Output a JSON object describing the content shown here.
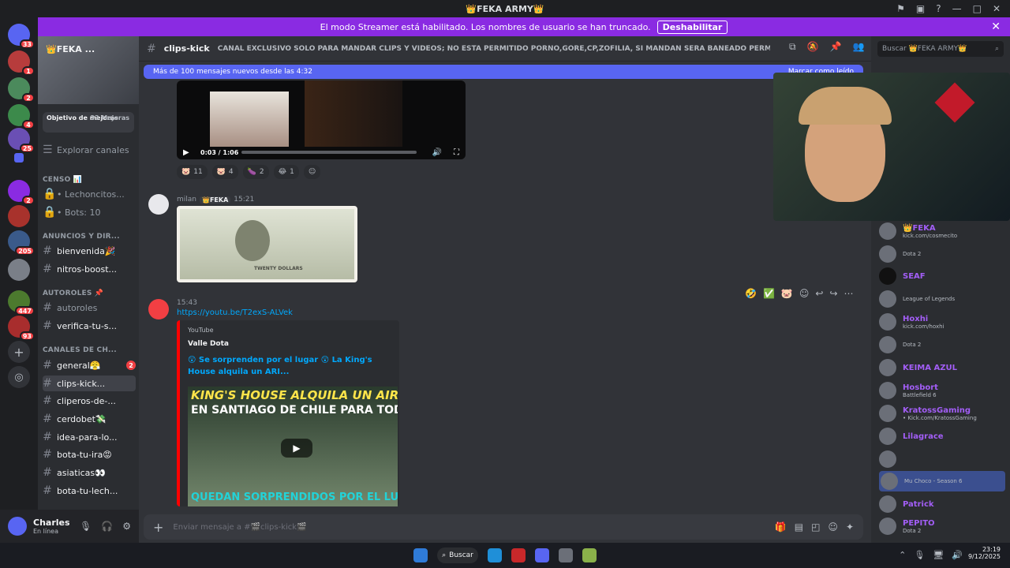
{
  "window": {
    "title": "👑FEKA ARMY👑",
    "controls": [
      "⚑",
      "▣",
      "?",
      "—",
      "□",
      "✕"
    ]
  },
  "banner": {
    "text": "El modo Streamer está habilitado. Los nombres de usuario se han truncado.",
    "button": "Deshabilitar",
    "close": "✕"
  },
  "guild_badges": [
    "33",
    "1",
    "2",
    "4",
    "25",
    "2",
    "205",
    "447",
    "93"
  ],
  "sidebar": {
    "server_name": "👑FEKA ...",
    "boost": {
      "label": "Objetivo de mejoras",
      "count": "33 Mejoras"
    },
    "explore": "Explorar canales",
    "categories": {
      "censo": "CENSO 📊",
      "anuncios": "ANUNCIOS Y DIR...",
      "autoroles": "AUTOROLES 📌",
      "canales": "CANALES DE CH..."
    },
    "items": [
      {
        "label": "• Lechoncitos..."
      },
      {
        "label": "• Bots: 10"
      },
      {
        "label": "bienvenida🎉"
      },
      {
        "label": "nitros-boost..."
      },
      {
        "label": "autoroles"
      },
      {
        "label": "verifica-tu-s..."
      },
      {
        "label": "general😤",
        "badge": "2"
      },
      {
        "label": "clips-kick..."
      },
      {
        "label": "cliperos-de-..."
      },
      {
        "label": "cerdobet💸"
      },
      {
        "label": "idea-para-lo..."
      },
      {
        "label": "bota-tu-ira😡"
      },
      {
        "label": "asiaticas👀"
      },
      {
        "label": "bota-tu-lech..."
      }
    ]
  },
  "user": {
    "name": "Charles",
    "status": "En línea"
  },
  "channel": {
    "name": "clips-kick",
    "topic": "CANAL EXCLUSIVO SOLO PARA MANDAR CLIPS Y VIDEOS; NO ESTA PERMITIDO PORNO,GORE,CP,ZOFILIA, SI MANDAN SERA BANEADO PERMANENTEMENTE",
    "new_messages": "Más de 100 mensajes nuevos desde las 4:32",
    "mark_read": "Marcar como leído"
  },
  "video": {
    "time": "0:03 / 1:06"
  },
  "reactions": [
    {
      "emoji": "🐷",
      "count": "11"
    },
    {
      "emoji": "🐷",
      "count": "4"
    },
    {
      "emoji": "🍆",
      "count": "2"
    },
    {
      "emoji": "😂",
      "count": "1"
    }
  ],
  "messages": [
    {
      "author": "milan",
      "tag": "👑FEKA",
      "time": "15:21"
    },
    {
      "author": "",
      "tag": "",
      "time": "15:43"
    }
  ],
  "bill": {
    "caption": "TWENTY DOLLARS"
  },
  "embed": {
    "link": "https://youtu.be/T2exS-ALVek",
    "provider": "YouTube",
    "author": "Valle Dota",
    "title": "😲 Se sorprenden por el lugar 😲 La King's House alquila un ARI...",
    "thumb_line1": "KING'S HOUSE ALQUILA UN AIRBNB",
    "thumb_line2": "EN SANTIAGO DE CHILE PARA TODOS",
    "thumb_line3": "QUEDAN SORPRENDIDOS POR EL LUGAR"
  },
  "composer": {
    "placeholder": "Enviar mensaje a #🎬clips-kick🎬"
  },
  "search": {
    "placeholder": "Buscar 👑FEKA ARMY👑"
  },
  "members": [
    {
      "name": "",
      "tag": "👑FEKA",
      "activity": "kick.com/cosmecito"
    },
    {
      "name": "",
      "activity": "Dota 2"
    },
    {
      "name": "",
      "tag": "SEAF",
      "activity": ""
    },
    {
      "name": "",
      "activity": "League of Legends"
    },
    {
      "name": "Hoxhi",
      "activity": "kick.com/hoxhi"
    },
    {
      "name": "",
      "activity": "Dota 2"
    },
    {
      "name": "KEIMA AZUL",
      "activity": ""
    },
    {
      "name": "Hosbort",
      "activity": "Battlefield 6"
    },
    {
      "name": "KratossGaming",
      "activity": "• Kick.com/KratossGaming"
    },
    {
      "name": "Lilagrace",
      "activity": ""
    },
    {
      "name": "",
      "activity": ""
    },
    {
      "name": "",
      "activity": "Mu Choco - Season 6"
    },
    {
      "name": "Patrick",
      "activity": ""
    },
    {
      "name": "PEPITO",
      "activity": "Dota 2"
    }
  ],
  "taskbar": {
    "search": "Buscar",
    "time": "23:19",
    "date": "9/12/2025"
  }
}
